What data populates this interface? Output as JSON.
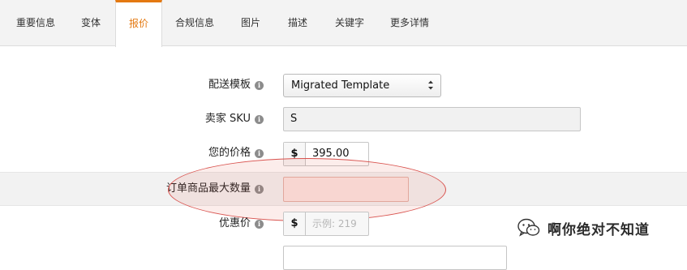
{
  "tabs": [
    {
      "label": "重要信息",
      "active": false
    },
    {
      "label": "变体",
      "active": false
    },
    {
      "label": "报价",
      "active": true
    },
    {
      "label": "合规信息",
      "active": false
    },
    {
      "label": "图片",
      "active": false
    },
    {
      "label": "描述",
      "active": false
    },
    {
      "label": "关键字",
      "active": false
    },
    {
      "label": "更多详情",
      "active": false
    }
  ],
  "form": {
    "shipping_template": {
      "label": "配送模板",
      "value": "Migrated Template",
      "icon": "info-icon"
    },
    "seller_sku": {
      "label": "卖家 SKU",
      "value": "S",
      "icon": "info-icon"
    },
    "your_price": {
      "label": "您的价格",
      "currency": "$",
      "value": "395.00",
      "icon": "info-icon"
    },
    "max_order_quantity": {
      "label": "订单商品最大数量",
      "value": "",
      "icon": "info-icon"
    },
    "sale_price": {
      "label": "优惠价",
      "currency": "$",
      "placeholder": "示例: 219",
      "icon": "info-icon"
    }
  },
  "watermark": {
    "text": "啊你绝对不知道",
    "icon": "wechat-icon"
  },
  "colors": {
    "accent": "#e47911",
    "highlight": "#d9534f"
  }
}
